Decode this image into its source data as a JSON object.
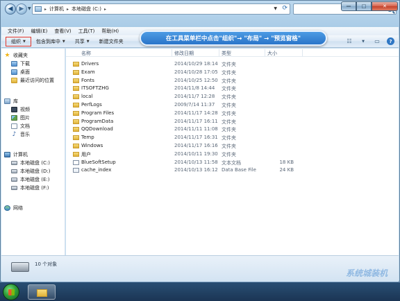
{
  "window": {
    "address": {
      "crumbs": [
        "计算机",
        "本地磁盘 (C:)"
      ]
    },
    "search": {
      "placeholder": ""
    },
    "caption": {
      "min": "—",
      "max": "□",
      "close": "✕"
    }
  },
  "menubar": [
    "文件(F)",
    "编辑(E)",
    "查看(V)",
    "工具(T)",
    "帮助(H)"
  ],
  "toolbar": {
    "organize": "组织",
    "include_in_library": "包含到库中",
    "share": "共享",
    "new_folder": "新建文件夹"
  },
  "callout": {
    "text": "在工具菜单栏中点击\"组织\"→ \"布局\" → \"预览窗格\""
  },
  "nav_pane": {
    "favorites": {
      "label": "收藏夹",
      "items": [
        "下载",
        "桌面",
        "最近访问的位置"
      ]
    },
    "libraries": {
      "label": "库",
      "items": [
        "视频",
        "图片",
        "文档",
        "音乐"
      ]
    },
    "computer": {
      "label": "计算机",
      "items": [
        "本地磁盘 (C:)",
        "本地磁盘 (D:)",
        "本地磁盘 (E:)",
        "本地磁盘 (F:)"
      ]
    },
    "network": {
      "label": "网络"
    }
  },
  "columns": {
    "name": "名称",
    "date": "修改日期",
    "type": "类型",
    "size": "大小"
  },
  "files": [
    {
      "name": "Drivers",
      "date": "2014/10/29 18:14",
      "type": "文件夹",
      "size": "",
      "kind": "folder"
    },
    {
      "name": "Exam",
      "date": "2014/10/28 17:05",
      "type": "文件夹",
      "size": "",
      "kind": "folder"
    },
    {
      "name": "Fonts",
      "date": "2014/10/25 12:50",
      "type": "文件夹",
      "size": "",
      "kind": "folder"
    },
    {
      "name": "ITSOFTZHG",
      "date": "2014/11/8 14:44",
      "type": "文件夹",
      "size": "",
      "kind": "folder"
    },
    {
      "name": "local",
      "date": "2014/11/7 12:28",
      "type": "文件夹",
      "size": "",
      "kind": "folder"
    },
    {
      "name": "PerfLogs",
      "date": "2009/7/14 11:37",
      "type": "文件夹",
      "size": "",
      "kind": "folder"
    },
    {
      "name": "Program Files",
      "date": "2014/11/17 14:28",
      "type": "文件夹",
      "size": "",
      "kind": "folder"
    },
    {
      "name": "ProgramData",
      "date": "2014/11/17 16:11",
      "type": "文件夹",
      "size": "",
      "kind": "folder"
    },
    {
      "name": "QQDownload",
      "date": "2014/11/11 11:08",
      "type": "文件夹",
      "size": "",
      "kind": "folder"
    },
    {
      "name": "Temp",
      "date": "2014/11/17 16:31",
      "type": "文件夹",
      "size": "",
      "kind": "folder"
    },
    {
      "name": "Windows",
      "date": "2014/11/17 16:16",
      "type": "文件夹",
      "size": "",
      "kind": "folder"
    },
    {
      "name": "用户",
      "date": "2014/10/11 19:30",
      "type": "文件夹",
      "size": "",
      "kind": "folder"
    },
    {
      "name": "BlueSoftSetup",
      "date": "2014/10/13 11:58",
      "type": "文本文档",
      "size": "18 KB",
      "kind": "txt"
    },
    {
      "name": "cache_index",
      "date": "2014/10/13 16:12",
      "type": "Data Base File",
      "size": "24 KB",
      "kind": "db"
    }
  ],
  "details": {
    "count": "10 个对象"
  },
  "watermark": "系统城装机"
}
